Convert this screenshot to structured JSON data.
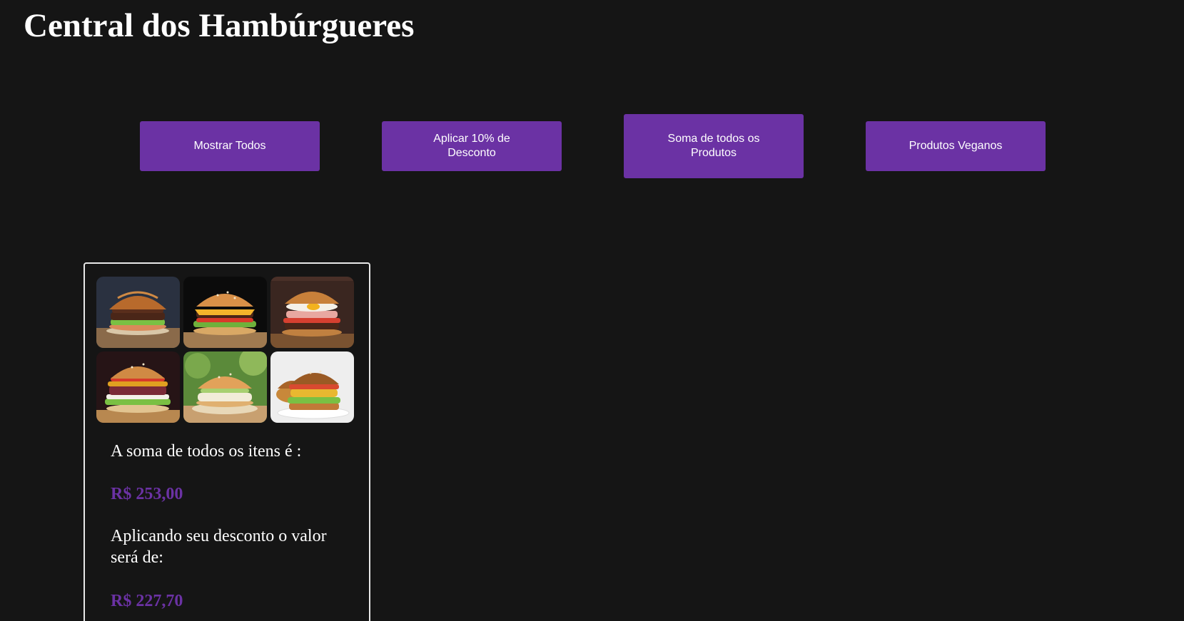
{
  "header": {
    "title": "Central dos Hambúrgueres"
  },
  "toolbar": {
    "show_all_label": "Mostrar Todos",
    "apply_discount_label": "Aplicar 10% de Desconto",
    "sum_all_label": "Soma de todos os Produtos",
    "vegan_label": "Produtos Veganos"
  },
  "result": {
    "sum_label": "A soma de todos os itens é :",
    "sum_value": "R$ 253,00",
    "discount_label": "Aplicando seu desconto o valor será de:",
    "discount_value": "R$ 227,70"
  },
  "products": [
    {
      "image": "burger-photo"
    },
    {
      "image": "cheeseburger-photo"
    },
    {
      "image": "egg-burger-photo"
    },
    {
      "image": "bacon-burger-photo"
    },
    {
      "image": "veggie-burger-photo"
    },
    {
      "image": "grilled-veggie-burger-photo"
    }
  ],
  "colors": {
    "background": "#151515",
    "accent": "#6b32a4",
    "text": "#ffffff",
    "card_border": "#e8e8e8"
  }
}
